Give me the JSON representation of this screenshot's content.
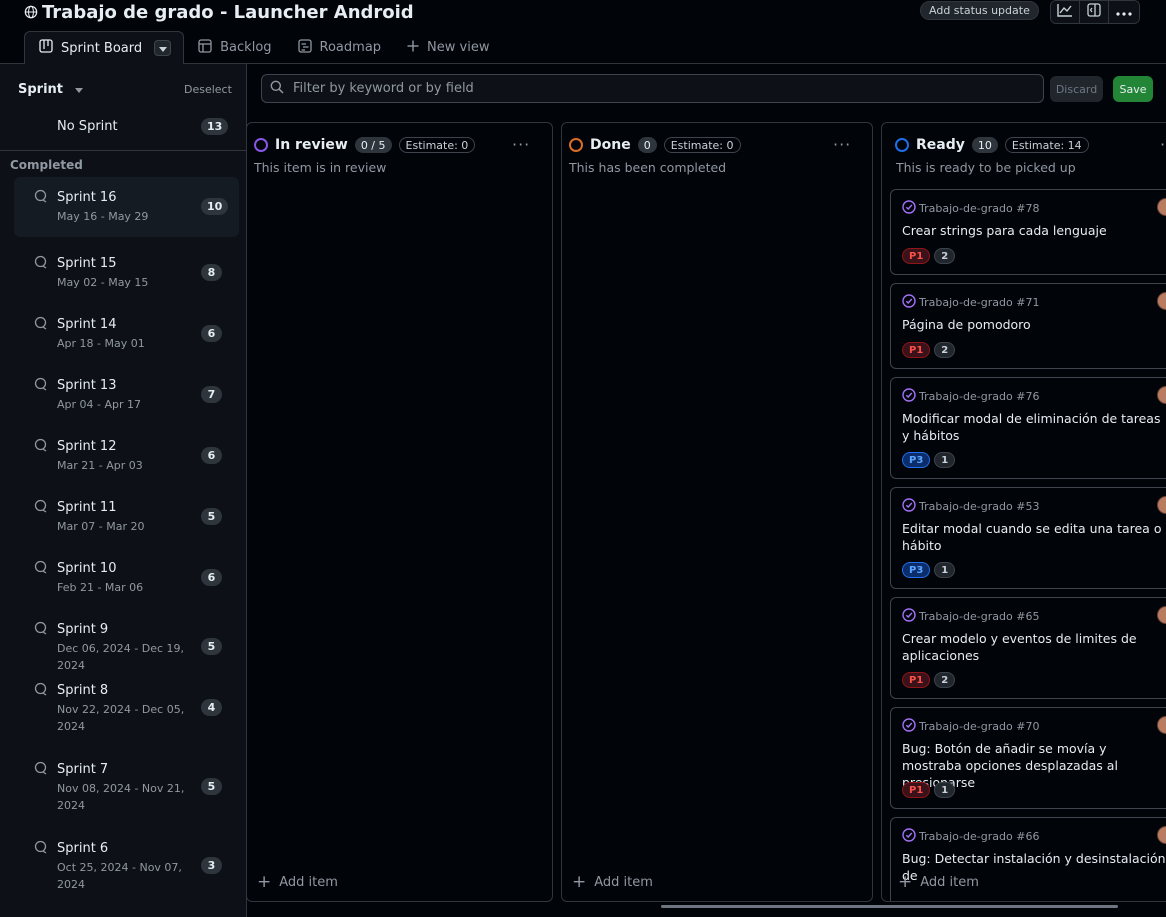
{
  "page": {
    "title": "Trabajo de grado - Launcher Android"
  },
  "header": {
    "status_button": "Add status update",
    "toolbar_icons": [
      "insights-icon",
      "panel-layout-icon",
      "kebab-icon"
    ]
  },
  "tabs": [
    {
      "label": "Sprint Board",
      "icon": "board-icon",
      "active": true
    },
    {
      "label": "Backlog",
      "icon": "table-icon"
    },
    {
      "label": "Roadmap",
      "icon": "roadmap-icon"
    },
    {
      "label": "New view",
      "icon": "plus-icon"
    }
  ],
  "sidebar": {
    "group_label": "Sprint",
    "deselect_label": "Deselect",
    "no_sprint": {
      "label": "No Sprint",
      "count": "13"
    },
    "completed_label": "Completed",
    "sprints": [
      {
        "name": "Sprint 16",
        "dates": "May 16 - May 29",
        "count": "10",
        "selected": true
      },
      {
        "name": "Sprint 15",
        "dates": "May 02 - May 15",
        "count": "8"
      },
      {
        "name": "Sprint 14",
        "dates": "Apr 18 - May 01",
        "count": "6"
      },
      {
        "name": "Sprint 13",
        "dates": "Apr 04 - Apr 17",
        "count": "7"
      },
      {
        "name": "Sprint 12",
        "dates": "Mar 21 - Apr 03",
        "count": "6"
      },
      {
        "name": "Sprint 11",
        "dates": "Mar 07 - Mar 20",
        "count": "5"
      },
      {
        "name": "Sprint 10",
        "dates": "Feb 21 - Mar 06",
        "count": "6"
      },
      {
        "name": "Sprint 9",
        "dates": "Dec 06, 2024 - Dec 19, 2024",
        "count": "5"
      },
      {
        "name": "Sprint 8",
        "dates": "Nov 22, 2024 - Dec 05, 2024",
        "count": "4"
      },
      {
        "name": "Sprint 7",
        "dates": "Nov 08, 2024 - Nov 21, 2024",
        "count": "5"
      },
      {
        "name": "Sprint 6",
        "dates": "Oct 25, 2024 - Nov 07, 2024",
        "count": "3"
      }
    ]
  },
  "filter": {
    "placeholder": "Filter by keyword or by field",
    "discard_label": "Discard",
    "save_label": "Save"
  },
  "columns": [
    {
      "name": "In review",
      "count": "0 / 5",
      "estimate": "Estimate: 0",
      "description": "This item is in review",
      "dot_color": "#8957e5"
    },
    {
      "name": "Done",
      "count": "0",
      "estimate": "Estimate: 0",
      "description": "This has been completed",
      "dot_color": "#db6d28"
    },
    {
      "name": "Ready",
      "count": "10",
      "estimate": "Estimate: 14",
      "description": "This is ready to be picked up",
      "dot_color": "#1f6feb"
    }
  ],
  "add_item_label": "Add item",
  "cards": [
    {
      "ref": "Trabajo-de-grado #78",
      "title": "Crear strings para cada lenguaje",
      "priority": "P1",
      "estimate": "2"
    },
    {
      "ref": "Trabajo-de-grado #71",
      "title": "Página de pomodoro",
      "priority": "P1",
      "estimate": "2"
    },
    {
      "ref": "Trabajo-de-grado #76",
      "title": "Modificar modal de eliminación de tareas y hábitos",
      "priority": "P3",
      "estimate": "1"
    },
    {
      "ref": "Trabajo-de-grado #53",
      "title": "Editar modal cuando se edita una tarea o hábito",
      "priority": "P3",
      "estimate": "1"
    },
    {
      "ref": "Trabajo-de-grado #65",
      "title": "Crear modelo y eventos de limites de aplicaciones",
      "priority": "P1",
      "estimate": "2"
    },
    {
      "ref": "Trabajo-de-grado #70",
      "title": "Bug: Botón de añadir se movía y mostraba opciones desplazadas al presionarse",
      "priority": "P1",
      "estimate": "1"
    },
    {
      "ref": "Trabajo-de-grado #66",
      "title": "Bug: Detectar instalación y desinstalación de"
    }
  ]
}
